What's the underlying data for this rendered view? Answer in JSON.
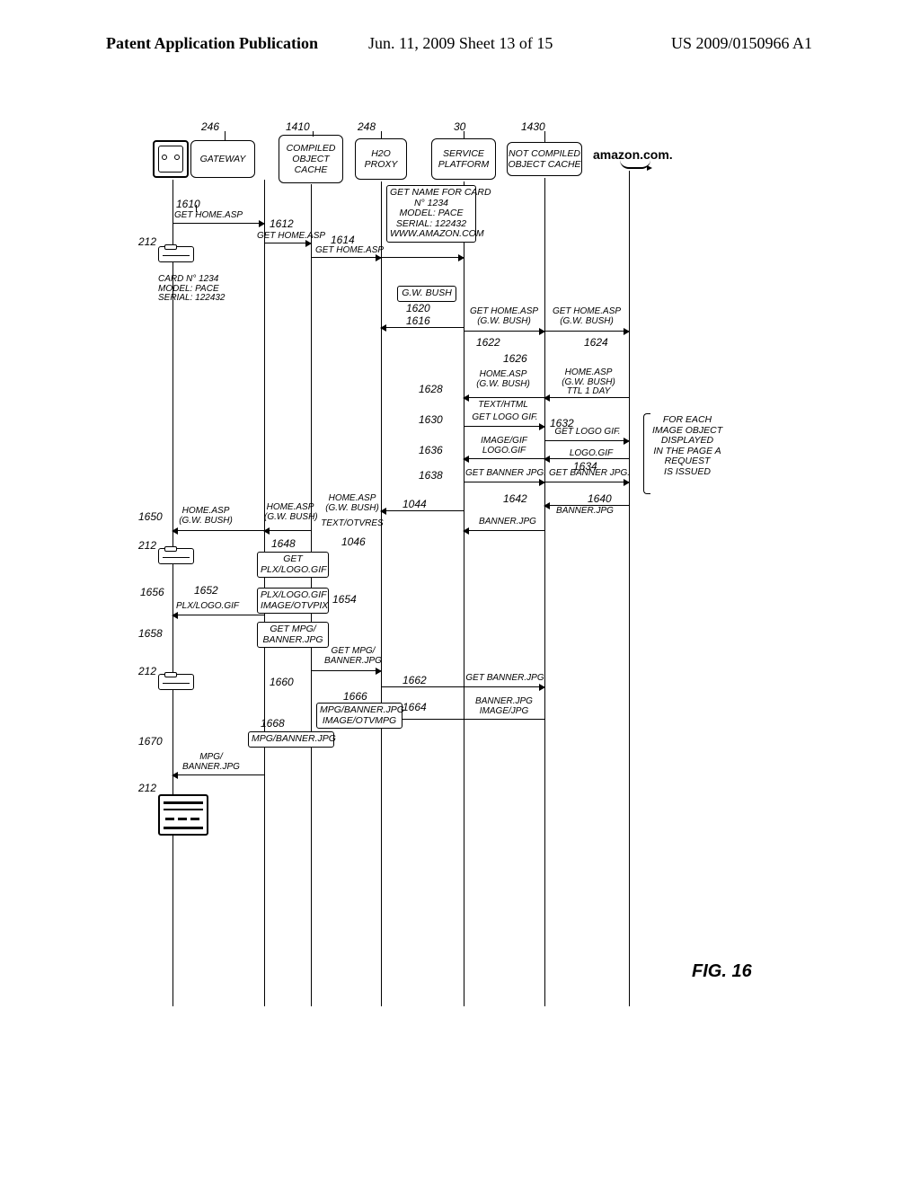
{
  "header": {
    "left": "Patent Application Publication",
    "mid": "Jun. 11, 2009  Sheet 13 of 15",
    "right": "US 2009/0150966 A1"
  },
  "figure_label": "FIG. 16",
  "lanes": {
    "gateway": {
      "label": "GATEWAY",
      "ref": "246"
    },
    "coc": {
      "label": "COMPILED\nOBJECT\nCACHE",
      "ref": "1410"
    },
    "proxy": {
      "label": "H2O\nPROXY",
      "ref": "248"
    },
    "sp": {
      "label": "SERVICE\nPLATFORM",
      "ref": "30"
    },
    "ncoc": {
      "label": "NOT COMPILED\nOBJECT CACHE",
      "ref": "1430"
    },
    "amazon": {
      "label": "amazon.com."
    }
  },
  "refs": {
    "r212a": "212",
    "r212b": "212",
    "r212c": "212",
    "r212d": "212",
    "r1610": "1610",
    "r1612": "1612",
    "r1614": "1614",
    "r1616": "1616",
    "r1620": "1620",
    "r1622": "1622",
    "r1624": "1624",
    "r1626": "1626",
    "r1628": "1628",
    "r1630": "1630",
    "r1632": "1632",
    "r1634": "1634",
    "r1636": "1636",
    "r1638": "1638",
    "r1640": "1640",
    "r1642": "1642",
    "r1044": "1044",
    "r1046": "1046",
    "r1648": "1648",
    "r1650": "1650",
    "r1652": "1652",
    "r1654": "1654",
    "r1656": "1656",
    "r1658": "1658",
    "r1660": "1660",
    "r1662": "1662",
    "r1664": "1664",
    "r1666": "1666",
    "r1668": "1668",
    "r1670": "1670"
  },
  "msgs": {
    "get_home_asp": "GET HOME.ASP",
    "card_info": "CARD N° 1234\nMODEL: PACE\nSERIAL: 122432",
    "get_name_card": "GET NAME FOR CARD\nN° 1234\nMODEL: PACE\nSERIAL: 122432\nWWW.AMAZON.COM",
    "gw_bush_box": "G.W. BUSH",
    "get_home_asp_gwb": "GET HOME.ASP\n(G.W. BUSH)",
    "home_asp_gwb": "HOME.ASP\n(G.W. BUSH)",
    "home_asp_gwb_ttl": "HOME.ASP\n(G.W. BUSH)\nTTL 1 DAY",
    "text_html": "TEXT/HTML",
    "get_logo_gif": "GET LOGO GIF.",
    "image_gif_logo": "IMAGE/GIF\nLOGO.GIF",
    "logo_gif": "LOGO.GIF",
    "get_banner_jpg": "GET BANNER JPG.",
    "banner_jpg": "BANNER.JPG",
    "home_asp_gwb2": "HOME.ASP\n(G.W. BUSH)",
    "text_otvres": "TEXT/OTVRES",
    "get_plx_logo": "GET PLX/LOGO.GIF",
    "plx_logo": "PLX/LOGO.GIF",
    "plx_logo_box": "PLX/LOGO.GIF\nIMAGE/OTVPIX",
    "get_mpg_banner": "GET MPG/\nBANNER.JPG",
    "mpg_banner_box": "MPG/BANNER.JPG\nIMAGE/OTVMPG",
    "mpg_banner": "MPG/\nBANNER.JPG",
    "get_banner_jpg2": "GET BANNER.JPG",
    "banner_jpg_img": "BANNER.JPG\nIMAGE/JPG",
    "mpg_banner_ret": "MPG/BANNER.JPG"
  },
  "side_note": "FOR EACH\nIMAGE OBJECT\nDISPLAYED\nIN THE PAGE A\nREQUEST\nIS ISSUED"
}
